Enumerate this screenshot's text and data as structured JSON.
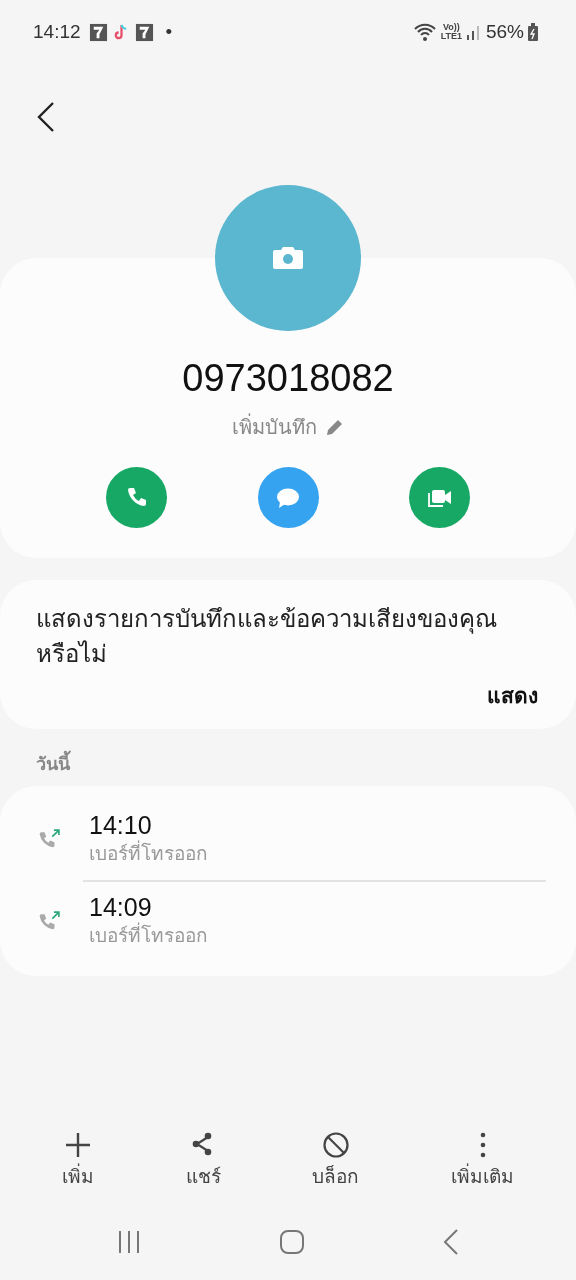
{
  "status_bar": {
    "time": "14:12",
    "notification_dot": "•",
    "volte": "Vo))",
    "network": "LTE1",
    "battery": "56%"
  },
  "contact": {
    "number": "0973018082",
    "note_link": "เพิ่มบันทึก",
    "actions": [
      {
        "kind": "call"
      },
      {
        "kind": "message"
      },
      {
        "kind": "video"
      }
    ]
  },
  "prompt": {
    "text": "แสดงรายการบันทึกและข้อความเสียงของคุณหรือไม่",
    "action": "แสดง"
  },
  "history": {
    "heading": "วันนี้",
    "calls": [
      {
        "kind": "outgoing",
        "time": "14:10",
        "label": "เบอร์ที่โทรออก"
      },
      {
        "kind": "outgoing",
        "time": "14:09",
        "label": "เบอร์ที่โทรออก"
      }
    ]
  },
  "toolbar": [
    {
      "kind": "add",
      "label": "เพิ่ม"
    },
    {
      "kind": "share",
      "label": "แชร์"
    },
    {
      "kind": "block",
      "label": "บล็อก"
    },
    {
      "kind": "more",
      "label": "เพิ่มเติม"
    }
  ]
}
